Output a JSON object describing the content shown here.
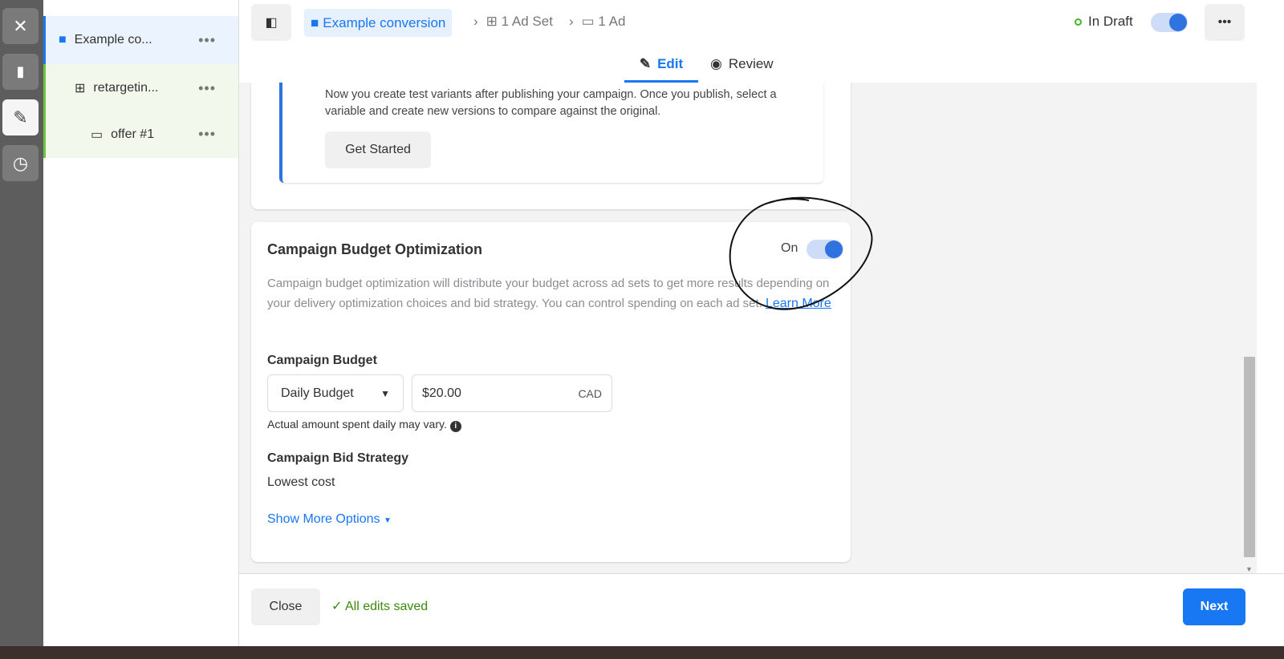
{
  "rail": {
    "icons": [
      "close-icon",
      "chart-icon",
      "pencil-icon",
      "clock-icon"
    ]
  },
  "tree": [
    {
      "label": "Example co...",
      "icon": "folder-icon"
    },
    {
      "label": "retargetin...",
      "icon": "grid-icon"
    },
    {
      "label": "offer #1",
      "icon": "ad-icon"
    }
  ],
  "breadcrumb": {
    "campaign": "Example conversion",
    "adset": "1 Ad Set",
    "ad": "1 Ad"
  },
  "status": {
    "label": "In Draft",
    "color": "#42b72a"
  },
  "tabs": {
    "edit": "Edit",
    "review": "Review"
  },
  "test_card": {
    "text": "Now you create test variants after publishing your campaign. Once you publish, select a variable and create new versions to compare against the original.",
    "button": "Get Started"
  },
  "cbo": {
    "title": "Campaign Budget Optimization",
    "toggle_label": "On",
    "toggle_on": true,
    "description": "Campaign budget optimization will distribute your budget across ad sets to get more results depending on your delivery optimization choices and bid strategy. You can control spending on each ad set.",
    "learn_more": "Learn More",
    "budget_label": "Campaign Budget",
    "budget_type": "Daily Budget",
    "budget_value": "$20.00",
    "currency": "CAD",
    "note": "Actual amount spent daily may vary.",
    "bid_label": "Campaign Bid Strategy",
    "bid_value": "Lowest cost",
    "more_options": "Show More Options"
  },
  "footer": {
    "close": "Close",
    "saved": "All edits saved",
    "next": "Next"
  },
  "colors": {
    "accent": "#1877f2",
    "saved": "#3b8a0a"
  }
}
